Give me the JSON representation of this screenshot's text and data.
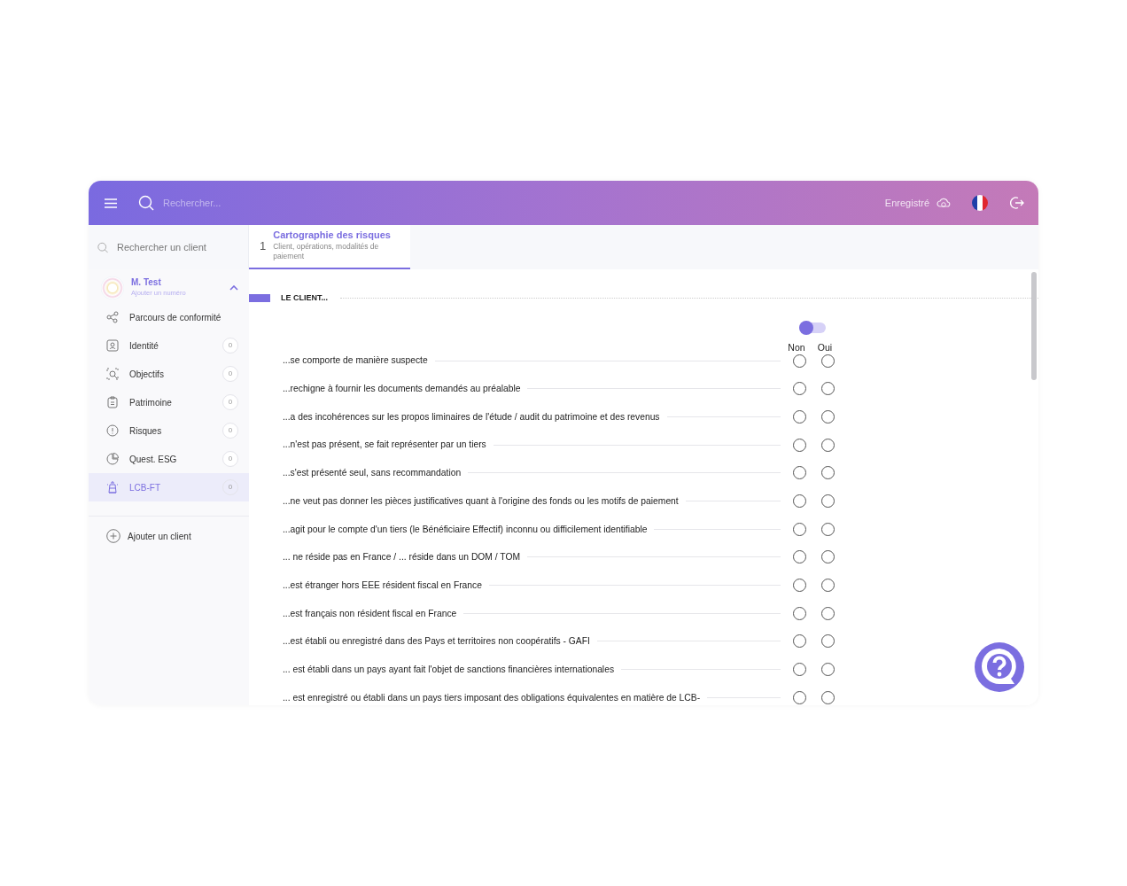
{
  "header": {
    "search": {
      "placeholder": "Rechercher..."
    },
    "save_status": "Enregistré"
  },
  "sidebar": {
    "search": {
      "placeholder": "Rechercher un client"
    },
    "client": {
      "name": "M. Test",
      "subtitle": "Ajouter un numéro",
      "expanded": true
    },
    "items": [
      {
        "kind": "route",
        "label": "Parcours de conformité",
        "selected": false
      },
      {
        "kind": "identity",
        "label": "Identité",
        "count": "0",
        "selected": false
      },
      {
        "kind": "target",
        "label": "Objectifs",
        "count": "0",
        "selected": false
      },
      {
        "kind": "clipboard",
        "label": "Patrimoine",
        "count": "0",
        "selected": false
      },
      {
        "kind": "alert",
        "label": "Risques",
        "count": "0",
        "selected": false
      },
      {
        "kind": "pie",
        "label": "Quest. ESG",
        "count": "0",
        "selected": false
      },
      {
        "kind": "tower",
        "label": "LCB-FT",
        "count": "0",
        "selected": true
      }
    ],
    "add_client": "Ajouter un client"
  },
  "tabs": [
    {
      "number": "1",
      "title": "Cartographie des risques",
      "subtitle": "Client, opérations, modalités de paiement",
      "selected": true
    }
  ],
  "section": {
    "title": "LE CLIENT...",
    "toggle": {
      "on": false
    },
    "columns": [
      "Non",
      "Oui"
    ],
    "questions": [
      {
        "text": "...se comporte de manière suspecte",
        "choices": [
          {
            "selected": false
          },
          {
            "selected": false
          }
        ]
      },
      {
        "text": "...rechigne à fournir les documents demandés au préalable",
        "choices": [
          {
            "selected": false
          },
          {
            "selected": false
          }
        ]
      },
      {
        "text": "...a des incohérences sur les propos liminaires de l'étude / audit du patrimoine et des revenus",
        "choices": [
          {
            "selected": false
          },
          {
            "selected": false
          }
        ]
      },
      {
        "text": "...n'est pas présent, se fait représenter par un tiers",
        "choices": [
          {
            "selected": false
          },
          {
            "selected": false
          }
        ]
      },
      {
        "text": "...s'est présenté seul, sans recommandation",
        "choices": [
          {
            "selected": false
          },
          {
            "selected": false
          }
        ]
      },
      {
        "text": "...ne veut pas donner les pièces justificatives quant à l'origine des fonds ou les motifs de paiement",
        "choices": [
          {
            "selected": false
          },
          {
            "selected": false
          }
        ]
      },
      {
        "text": "...agit pour le compte d'un tiers (le Bénéficiaire Effectif) inconnu ou difficilement identifiable",
        "choices": [
          {
            "selected": false
          },
          {
            "selected": false
          }
        ]
      },
      {
        "text": "... ne réside pas en France / ... réside dans un DOM / TOM",
        "choices": [
          {
            "selected": false
          },
          {
            "selected": false
          }
        ]
      },
      {
        "text": "...est étranger hors EEE résident fiscal en France",
        "choices": [
          {
            "selected": false
          },
          {
            "selected": false
          }
        ]
      },
      {
        "text": "...est français non résident fiscal en France",
        "choices": [
          {
            "selected": false
          },
          {
            "selected": false
          }
        ]
      },
      {
        "text": "...est établi ou enregistré dans des Pays et territoires non coopératifs - GAFI",
        "choices": [
          {
            "selected": false
          },
          {
            "selected": false
          }
        ]
      },
      {
        "text": "... est établi dans un pays ayant fait l'objet de sanctions financières internationales",
        "choices": [
          {
            "selected": false
          },
          {
            "selected": false
          }
        ]
      },
      {
        "text": "... est enregistré ou établi dans un pays tiers imposant des obligations équivalentes en matière de LCB-",
        "choices": [
          {
            "selected": false
          },
          {
            "selected": false
          }
        ]
      }
    ]
  }
}
